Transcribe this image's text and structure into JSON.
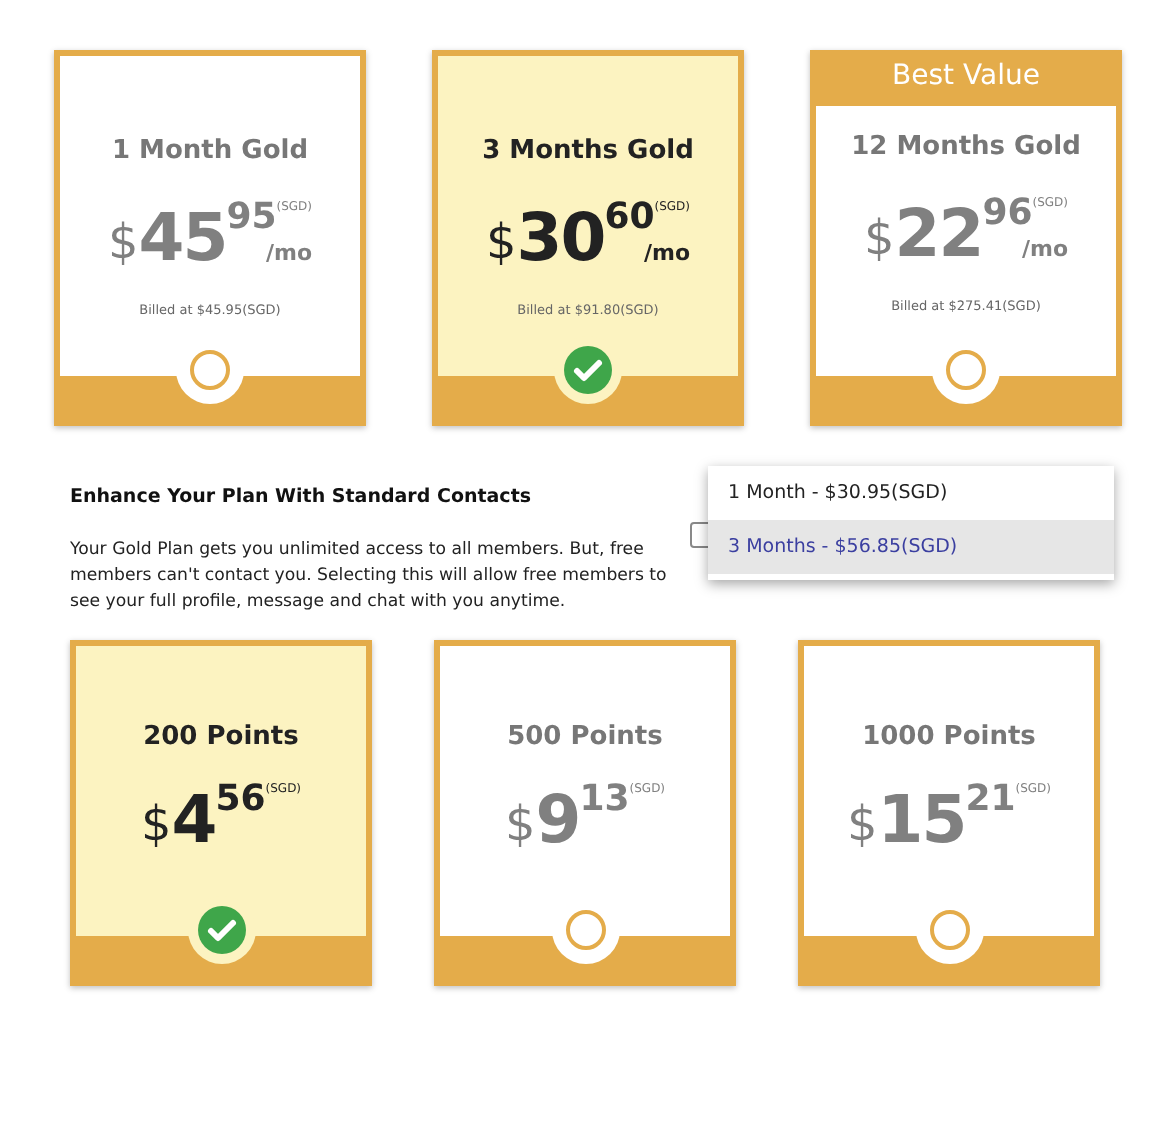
{
  "plans": [
    {
      "title": "1 Month Gold",
      "currency": "$",
      "whole": "45",
      "cents": "95",
      "code": "(SGD)",
      "per": "/mo",
      "billed": "Billed at $45.95(SGD)",
      "selected": false
    },
    {
      "title": "3 Months Gold",
      "currency": "$",
      "whole": "30",
      "cents": "60",
      "code": "(SGD)",
      "per": "/mo",
      "billed": "Billed at $91.80(SGD)",
      "selected": true
    },
    {
      "title": "12 Months Gold",
      "banner": "Best Value",
      "currency": "$",
      "whole": "22",
      "cents": "96",
      "code": "(SGD)",
      "per": "/mo",
      "billed": "Billed at $275.41(SGD)",
      "selected": false
    }
  ],
  "addon": {
    "heading": "Enhance Your Plan With Standard Contacts",
    "description": "Your Gold Plan gets you unlimited access to all members. But, free members can't contact you. Selecting this will allow free members to see your full profile, message and chat with you anytime.",
    "checked": false,
    "options": [
      {
        "label": "1 Month - $30.95(SGD)",
        "selected": false
      },
      {
        "label": "3 Months - $56.85(SGD)",
        "selected": true
      }
    ]
  },
  "points": [
    {
      "title": "200 Points",
      "currency": "$",
      "whole": "4",
      "cents": "56",
      "code": "(SGD)",
      "selected": true
    },
    {
      "title": "500 Points",
      "currency": "$",
      "whole": "9",
      "cents": "13",
      "code": "(SGD)",
      "selected": false
    },
    {
      "title": "1000 Points",
      "currency": "$",
      "whole": "15",
      "cents": "21",
      "code": "(SGD)",
      "selected": false
    }
  ]
}
